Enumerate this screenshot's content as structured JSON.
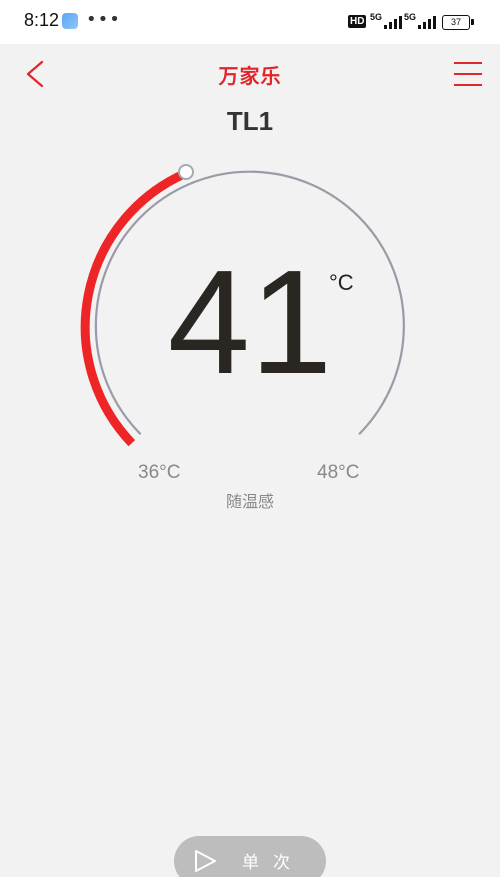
{
  "status_bar": {
    "time": "8:12",
    "dots": "•••",
    "hd": "HD",
    "network_1": "5G",
    "network_2": "5G",
    "battery": "37"
  },
  "header": {
    "brand": "万家乐",
    "device_name": "TL1"
  },
  "thermostat": {
    "current_temperature": "41",
    "unit": "°C",
    "min_label": "36°C",
    "max_label": "48°C",
    "min_value": 36,
    "max_value": 48,
    "mode_label": "随温感"
  },
  "bottom_action": {
    "label": "单次"
  },
  "colors": {
    "accent": "#e0262a",
    "arc_track": "#9b9ba8",
    "background": "#f2f2f2"
  },
  "icons": {
    "back": "chevron-left-icon",
    "menu": "hamburger-menu-icon",
    "play": "play-triangle-icon"
  }
}
